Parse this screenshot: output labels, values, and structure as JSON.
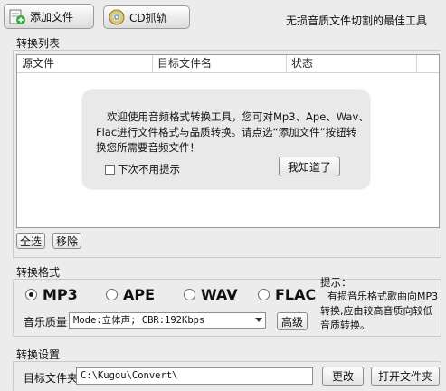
{
  "toolbar": {
    "add_file_label": "添加文件",
    "cd_rip_label": "CD抓轨",
    "slogan": "无损音质文件切割的最佳工具"
  },
  "convert_list": {
    "group_title": "转换列表",
    "columns": [
      "源文件",
      "目标文件名",
      "状态"
    ],
    "rows": []
  },
  "welcome_popup": {
    "message_line1": "欢迎使用音频格式转换工具，您可对Mp3、Ape、Wav、",
    "message_line2": "Flac进行文件格式与品质转换。请点选“添加文件”按钮转",
    "message_line3": "换您所需要音频文件！",
    "dont_show_label": "下次不用提示",
    "dont_show_checked": false,
    "ok_button": "我知道了"
  },
  "list_actions": {
    "select_all": "全选",
    "remove": "移除"
  },
  "format": {
    "group_title": "转换格式",
    "options": [
      "MP3",
      "APE",
      "WAV",
      "FLAC"
    ],
    "selected": "MP3",
    "quality_label": "音乐质量",
    "quality_value": "Mode:立体声; CBR:192Kbps",
    "advanced_button": "高级",
    "hint_title": "提示：",
    "hint_line1": "有损音乐格式歌曲向MP3",
    "hint_line2": "转换,应由较高音质向较低",
    "hint_line3": "音质转换。"
  },
  "settings": {
    "group_title": "转换设置",
    "target_folder_label": "目标文件夹",
    "target_folder_value": "C:\\Kugou\\Convert\\",
    "change_button": "更改",
    "open_folder_button": "打开文件夹"
  },
  "colors": {
    "window_bg": "#ececec",
    "list_bg": "#ffffff",
    "popup_bg": "#e9e9e9"
  }
}
